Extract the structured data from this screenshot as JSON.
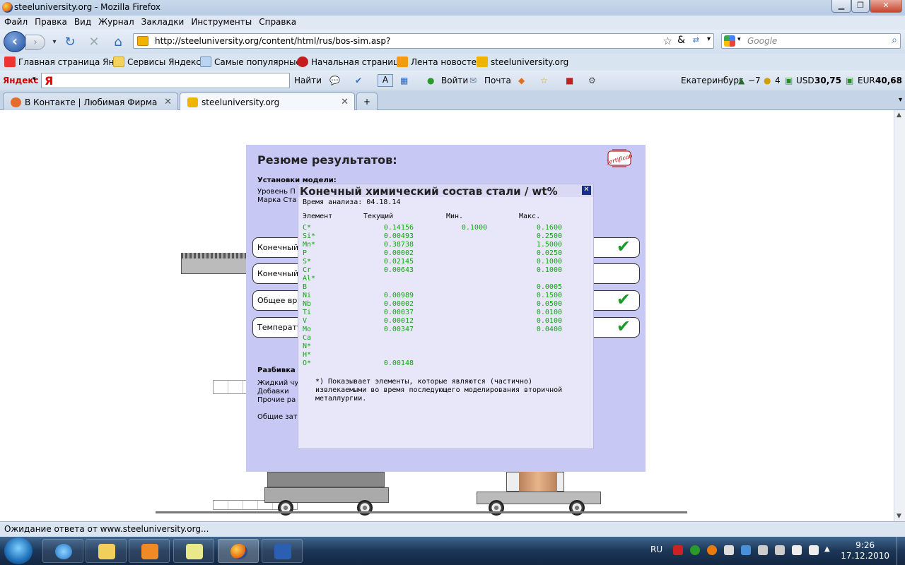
{
  "window": {
    "title": "steeluniversity.org - Mozilla Firefox"
  },
  "menu": [
    "Файл",
    "Правка",
    "Вид",
    "Журнал",
    "Закладки",
    "Инструменты",
    "Справка"
  ],
  "nav": {
    "url": "http://steeluniversity.org/content/html/rus/bos-sim.asp?",
    "search_placeholder": "Google"
  },
  "bookmarks": [
    "Главная страница Ян...",
    "Сервисы Яндекса",
    "Самые популярные",
    "Начальная страница",
    "Лента новостей",
    "steeluniversity.org"
  ],
  "yandex": {
    "logo": "Яндекс",
    "logo_letter": "Я",
    "find": "Найти",
    "login": "Войти",
    "mail": "Почта",
    "city": "Екатеринбург",
    "temp": "−7",
    "level": "4",
    "usd_label": "USD",
    "usd": "30,75",
    "eur_label": "EUR",
    "eur": "40,68"
  },
  "tabs": [
    {
      "label": "В Контакте | Любимая Фирма",
      "active": false
    },
    {
      "label": "steeluniversity.org",
      "active": true
    }
  ],
  "status": "Ожидание ответа от www.steeluniversity.org...",
  "taskbar": {
    "lang": "RU",
    "time": "9:26",
    "date": "17.12.2010"
  },
  "summary": {
    "title": "Резюме результатов:",
    "settings_label": "Установки модели:",
    "level_label": "Уровень П",
    "grade_label": "Марка Ста",
    "certificate": "Certificate",
    "rows": [
      "Конечный",
      "Конечный",
      "Общее вр",
      "Температу"
    ],
    "breakdown_label": "Разбивка",
    "breakdown_items": [
      "Жидкий чу",
      "Добавки",
      "Прочие ра"
    ],
    "total_label": "Общие зат"
  },
  "modal": {
    "title": "Конечный химический состав стали / wt%",
    "time": "Время анализа: 04.18.14",
    "headers": {
      "element": "Элемент",
      "current": "Текущий",
      "min": "Мин.",
      "max": "Макс."
    },
    "rows": [
      {
        "el": "C*",
        "cur": "0.14156",
        "min": "0.1000",
        "max": "0.1600"
      },
      {
        "el": "Si*",
        "cur": "0.00493",
        "min": "",
        "max": "0.2500"
      },
      {
        "el": "Mn*",
        "cur": "0.38738",
        "min": "",
        "max": "1.5000"
      },
      {
        "el": "P",
        "cur": "0.00002",
        "min": "",
        "max": "0.0250"
      },
      {
        "el": "S*",
        "cur": "0.02145",
        "min": "",
        "max": "0.1000"
      },
      {
        "el": "Cr",
        "cur": "0.00643",
        "min": "",
        "max": "0.1000"
      },
      {
        "el": "Al*",
        "cur": "",
        "min": "",
        "max": ""
      },
      {
        "el": "B",
        "cur": "",
        "min": "",
        "max": "0.0005"
      },
      {
        "el": "Ni",
        "cur": "0.00989",
        "min": "",
        "max": "0.1500"
      },
      {
        "el": "Nb",
        "cur": "0.00002",
        "min": "",
        "max": "0.0500"
      },
      {
        "el": "Ti",
        "cur": "0.00037",
        "min": "",
        "max": "0.0100"
      },
      {
        "el": "V",
        "cur": "0.00012",
        "min": "",
        "max": "0.0100"
      },
      {
        "el": "Mo",
        "cur": "0.00347",
        "min": "",
        "max": "0.0400"
      },
      {
        "el": "Ca",
        "cur": "",
        "min": "",
        "max": ""
      },
      {
        "el": "N*",
        "cur": "",
        "min": "",
        "max": ""
      },
      {
        "el": "H*",
        "cur": "",
        "min": "",
        "max": ""
      },
      {
        "el": "O*",
        "cur": "0.00148",
        "min": "",
        "max": ""
      }
    ],
    "footnote": "*) Показывает элементы, которые являются (частично) извлекаемыми во время последующего моделирования вторичной металлургии."
  }
}
